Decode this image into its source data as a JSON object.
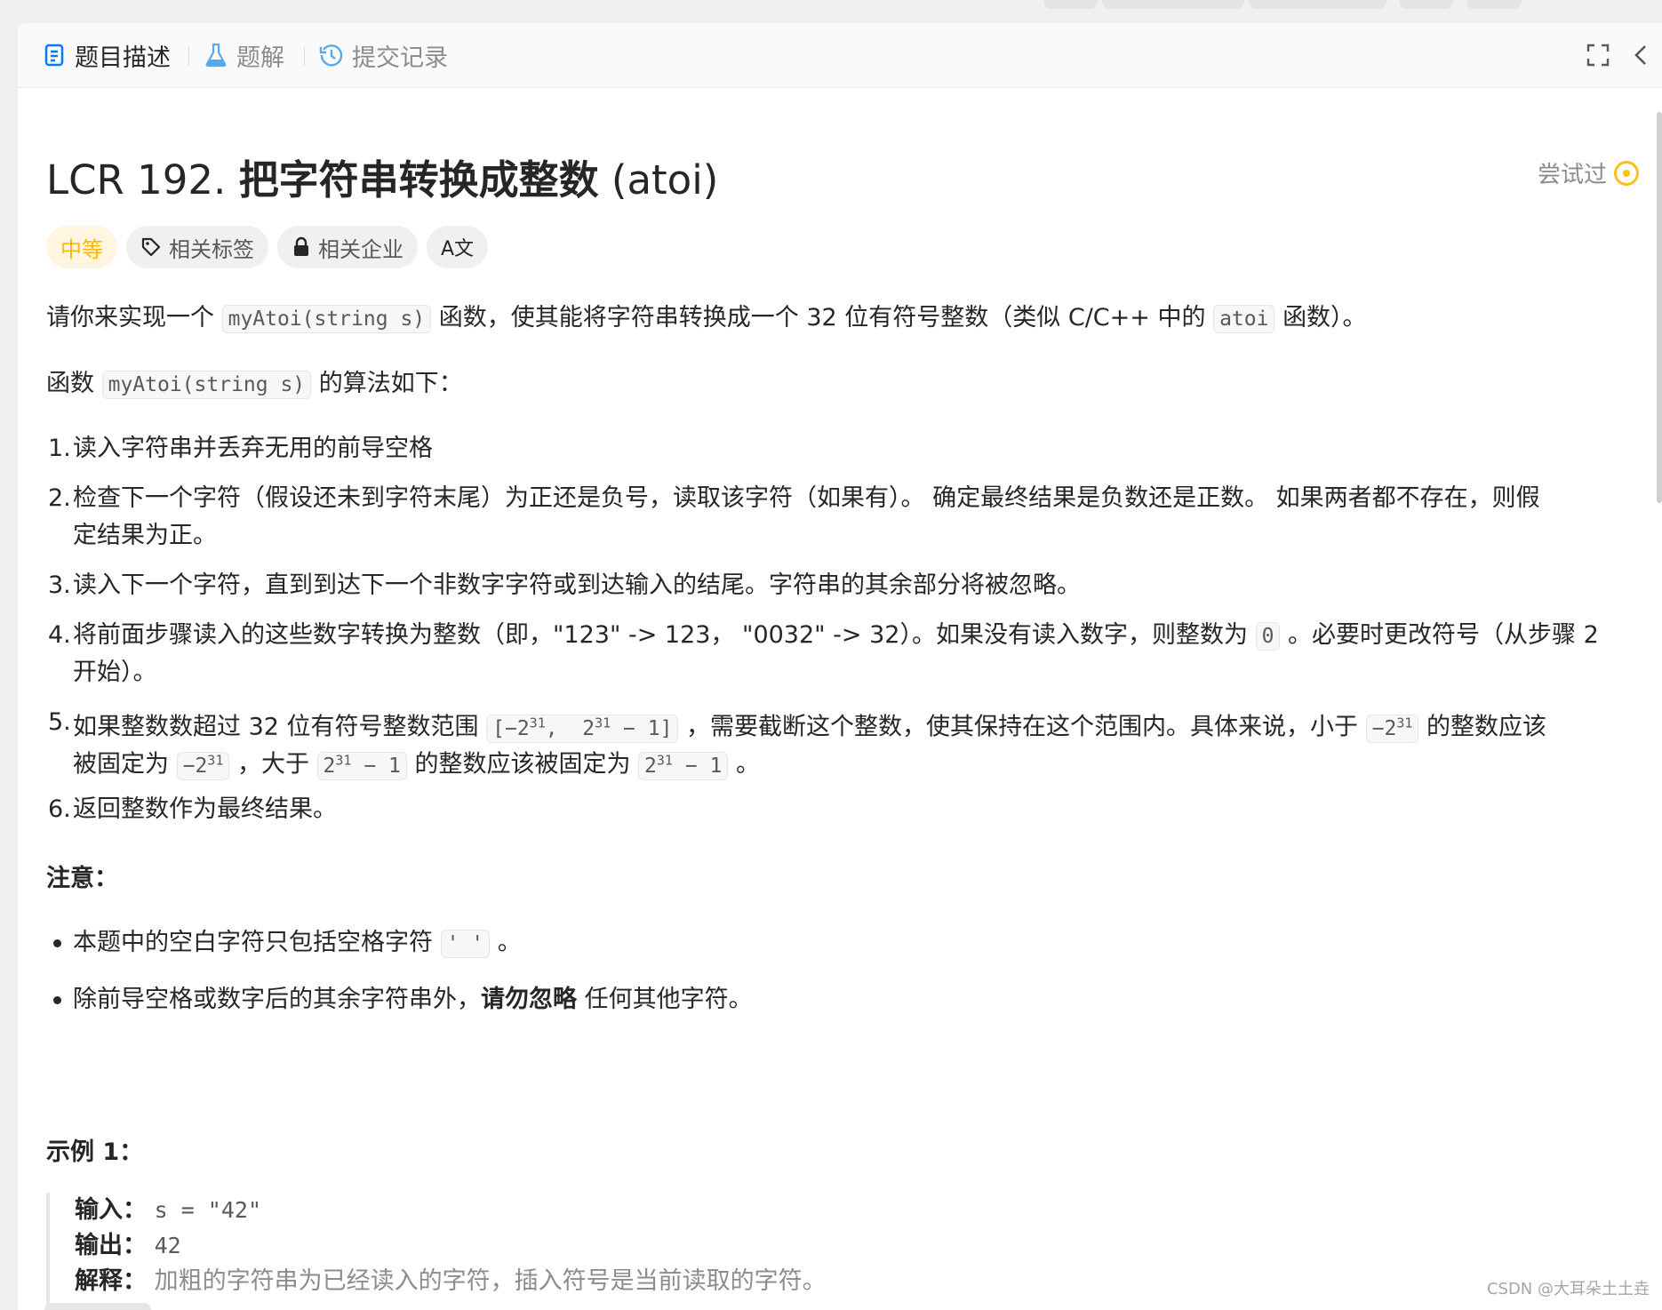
{
  "tabs": [
    {
      "label": "题目描述",
      "icon": "document-icon",
      "active": true
    },
    {
      "label": "题解",
      "icon": "flask-icon",
      "active": false
    },
    {
      "label": "提交记录",
      "icon": "history-icon",
      "active": false
    }
  ],
  "toolbar": {
    "fullscreen_icon": "fullscreen-icon",
    "collapse_icon": "chevron-left-icon"
  },
  "problem": {
    "id": "LCR 192.",
    "title_cn": "把字符串转换成整数",
    "title_en": "(atoi)",
    "status": "尝试过",
    "status_color": "#ffc01e"
  },
  "tags": {
    "difficulty": "中等",
    "difficulty_color": "#ffb800",
    "related_tags": "相关标签",
    "related_companies": "相关企业",
    "translate": "A文"
  },
  "description": {
    "p1_a": "请你来实现一个",
    "p1_code": "myAtoi(string s)",
    "p1_b": "函数，使其能将字符串转换成一个 32 位有符号整数（类似 C/C++ 中的",
    "p1_code2": "atoi",
    "p1_c": "函数）。",
    "p2_a": "函数",
    "p2_code": "myAtoi(string s)",
    "p2_b": "的算法如下："
  },
  "steps": {
    "s1": "读入字符串并丢弃无用的前导空格",
    "s2_l1": "检查下一个字符（假设还未到字符末尾）为正还是负号，读取该字符（如果有）。 确定最终结果是负数还是正数。 如果两者都不存在，则假",
    "s2_l2": "定结果为正。",
    "s3": "读入下一个字符，直到到达下一个非数字字符或到达输入的结尾。字符串的其余部分将被忽略。",
    "s4_a": "将前面步骤读入的这些数字转换为整数（即，\"123\" -> 123， \"0032\" -> 32）。如果没有读入数字，则整数为",
    "s4_code": "0",
    "s4_b": "。必要时更改符号（从步骤 2",
    "s4_l2": "开始）。",
    "s5_a": "如果整数数超过 32 位有符号整数范围",
    "s5_b": "，需要截断这个整数，使其保持在这个范围内。具体来说，小于",
    "s5_c": "的整数应该",
    "s5_d": "被固定为",
    "s5_e": "，大于",
    "s5_f": "的整数应该被固定为",
    "s5_g": "。",
    "s6": "返回整数作为最终结果。"
  },
  "note": {
    "heading": "注意：",
    "b1_a": "本题中的空白字符只包括空格字符",
    "b1_code": "' '",
    "b1_b": "。",
    "b2_a": "除前导空格或数字后的其余字符串外，",
    "b2_bold": "请勿忽略",
    "b2_b": "任何其他字符。"
  },
  "example1": {
    "heading": "示例 1：",
    "input_label": "输入：",
    "input_value": "s = \"42\"",
    "output_label": "输出：",
    "output_value": "42",
    "explain_label": "解释：",
    "explain_value": "加粗的字符串为已经读入的字符，插入符号是当前读取的字符。"
  },
  "watermark": "CSDN @大耳朵土土垚"
}
